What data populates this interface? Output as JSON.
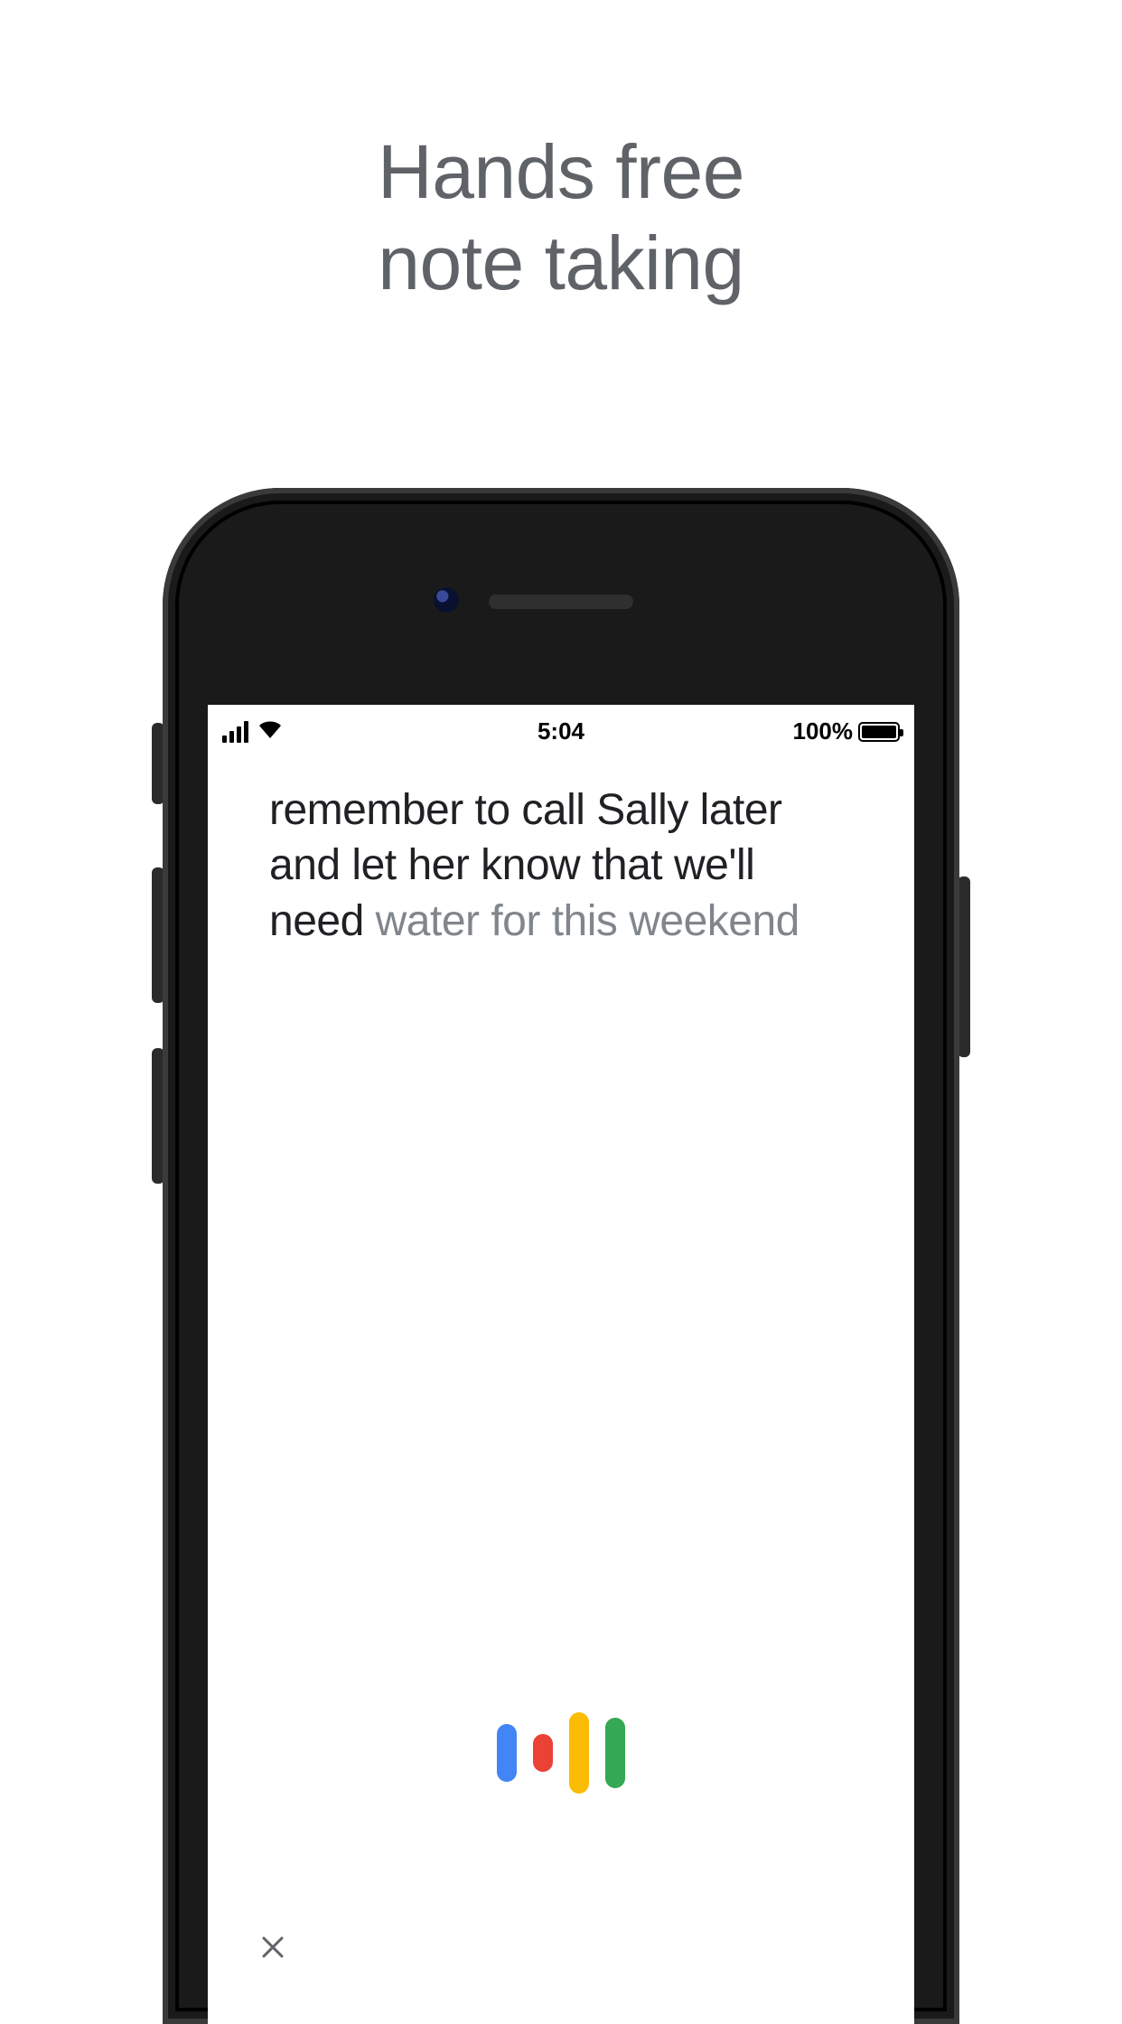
{
  "marketing": {
    "headline_line1": "Hands free",
    "headline_line2": "note taking"
  },
  "statusbar": {
    "time": "5:04",
    "battery_label": "100%"
  },
  "note": {
    "confirmed_text": "remember to call Sally later and let her know that we'll need ",
    "tentative_text": "water for this weekend"
  },
  "colors": {
    "blue": "#4285F4",
    "red": "#EA4335",
    "yellow": "#FBBC05",
    "green": "#34A853",
    "text_primary": "#202124",
    "text_secondary": "#5f6368",
    "text_tentative": "#80868b"
  },
  "icons": {
    "signal": "cellular-signal-icon",
    "wifi": "wifi-icon",
    "battery": "battery-full-icon",
    "voice": "google-voice-bars-icon",
    "close": "close-icon"
  }
}
